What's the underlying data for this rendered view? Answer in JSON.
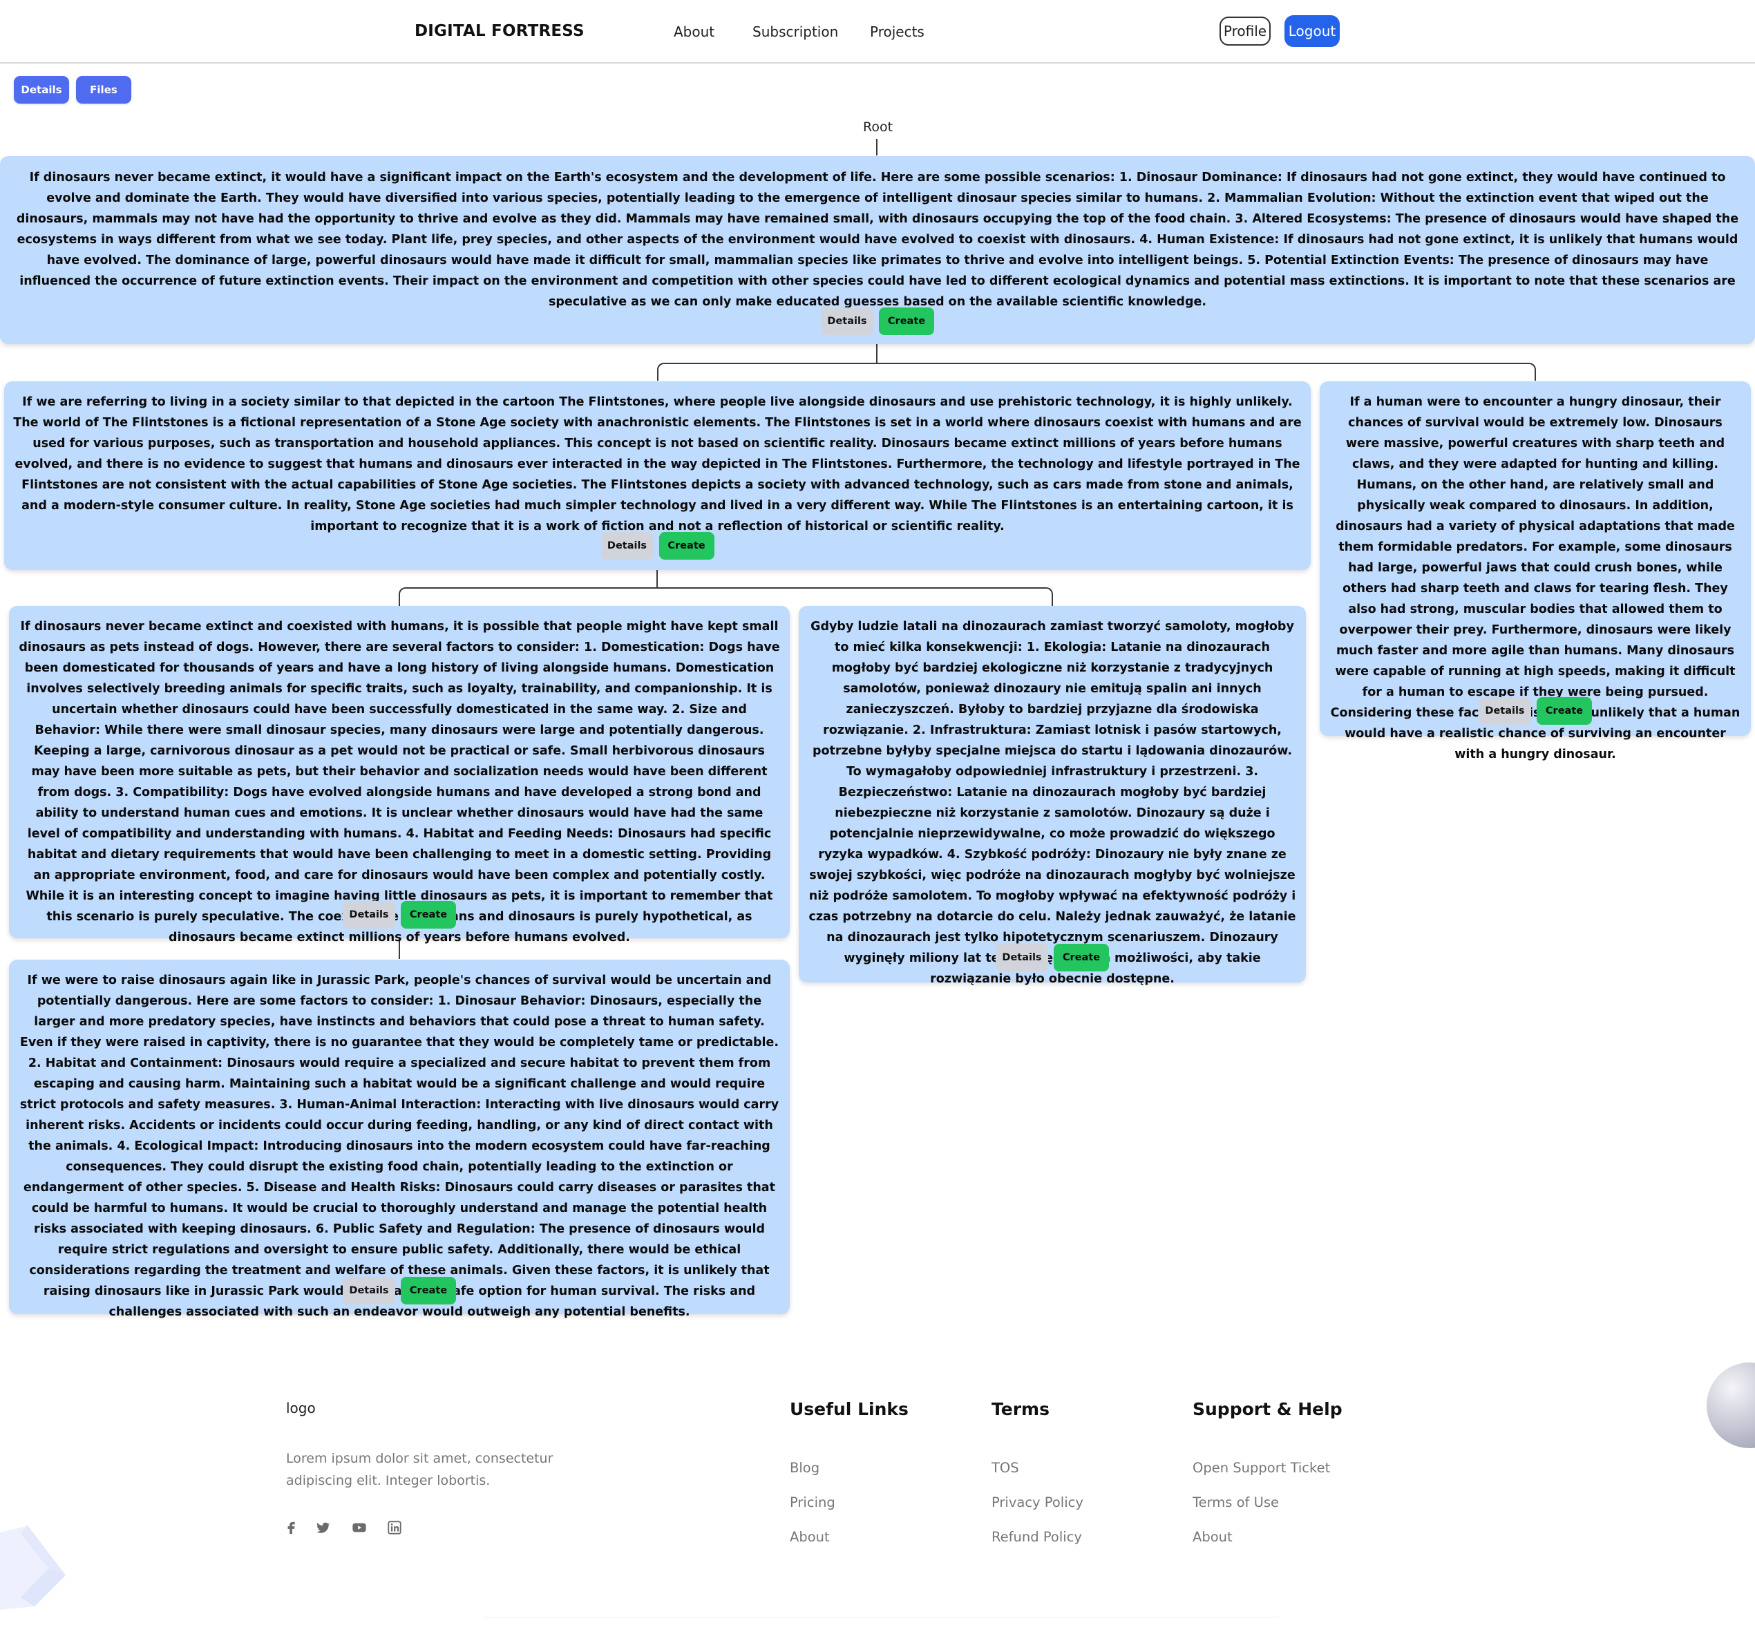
{
  "header": {
    "brand": "DIGITAL FORTRESS",
    "nav": [
      "About",
      "Subscription",
      "Projects"
    ],
    "profile_label": "Profile",
    "logout_label": "Logout"
  },
  "toolbar": {
    "details_label": "Details",
    "files_label": "Files"
  },
  "tree": {
    "root_label": "Root",
    "node_buttons": {
      "details": "Details",
      "create": "Create"
    },
    "nodes": [
      {
        "text": "If dinosaurs never became extinct, it would have a significant impact on the Earth's ecosystem and the development of life. Here are some possible scenarios: 1. Dinosaur Dominance: If dinosaurs had not gone extinct, they would have continued to evolve and dominate the Earth. They would have diversified into various species, potentially leading to the emergence of intelligent dinosaur species similar to humans. 2. Mammalian Evolution: Without the extinction event that wiped out the dinosaurs, mammals may not have had the opportunity to thrive and evolve as they did. Mammals may have remained small, with dinosaurs occupying the top of the food chain. 3. Altered Ecosystems: The presence of dinosaurs would have shaped the ecosystems in ways different from what we see today. Plant life, prey species, and other aspects of the environment would have evolved to coexist with dinosaurs. 4. Human Existence: If dinosaurs had not gone extinct, it is unlikely that humans would have evolved. The dominance of large, powerful dinosaurs would have made it difficult for small, mammalian species like primates to thrive and evolve into intelligent beings. 5. Potential Extinction Events: The presence of dinosaurs may have influenced the occurrence of future extinction events. Their impact on the environment and competition with other species could have led to different ecological dynamics and potential mass extinctions. It is important to note that these scenarios are speculative as we can only make educated guesses based on the available scientific knowledge."
      },
      {
        "text": "If we are referring to living in a society similar to that depicted in the cartoon The Flintstones, where people live alongside dinosaurs and use prehistoric technology, it is highly unlikely. The world of The Flintstones is a fictional representation of a Stone Age society with anachronistic elements. The Flintstones is set in a world where dinosaurs coexist with humans and are used for various purposes, such as transportation and household appliances. This concept is not based on scientific reality. Dinosaurs became extinct millions of years before humans evolved, and there is no evidence to suggest that humans and dinosaurs ever interacted in the way depicted in The Flintstones. Furthermore, the technology and lifestyle portrayed in The Flintstones are not consistent with the actual capabilities of Stone Age societies. The Flintstones depicts a society with advanced technology, such as cars made from stone and animals, and a modern-style consumer culture. In reality, Stone Age societies had much simpler technology and lived in a very different way. While The Flintstones is an entertaining cartoon, it is important to recognize that it is a work of fiction and not a reflection of historical or scientific reality."
      },
      {
        "text": "If a human were to encounter a hungry dinosaur, their chances of survival would be extremely low. Dinosaurs were massive, powerful creatures with sharp teeth and claws, and they were adapted for hunting and killing. Humans, on the other hand, are relatively small and physically weak compared to dinosaurs. In addition, dinosaurs had a variety of physical adaptations that made them formidable predators. For example, some dinosaurs had large, powerful jaws that could crush bones, while others had sharp teeth and claws for tearing flesh. They also had strong, muscular bodies that allowed them to overpower their prey. Furthermore, dinosaurs were likely much faster and more agile than humans. Many dinosaurs were capable of running at high speeds, making it difficult for a human to escape if they were being pursued. Considering these factors, it is highly unlikely that a human would have a realistic chance of surviving an encounter with a hungry dinosaur."
      },
      {
        "text": "If dinosaurs never became extinct and coexisted with humans, it is possible that people might have kept small dinosaurs as pets instead of dogs. However, there are several factors to consider: 1. Domestication: Dogs have been domesticated for thousands of years and have a long history of living alongside humans. Domestication involves selectively breeding animals for specific traits, such as loyalty, trainability, and companionship. It is uncertain whether dinosaurs could have been successfully domesticated in the same way. 2. Size and Behavior: While there were small dinosaur species, many dinosaurs were large and potentially dangerous. Keeping a large, carnivorous dinosaur as a pet would not be practical or safe. Small herbivorous dinosaurs may have been more suitable as pets, but their behavior and socialization needs would have been different from dogs. 3. Compatibility: Dogs have evolved alongside humans and have developed a strong bond and ability to understand human cues and emotions. It is unclear whether dinosaurs would have had the same level of compatibility and understanding with humans. 4. Habitat and Feeding Needs: Dinosaurs had specific habitat and dietary requirements that would have been challenging to meet in a domestic setting. Providing an appropriate environment, food, and care for dinosaurs would have been complex and potentially costly. While it is an interesting concept to imagine having little dinosaurs as pets, it is important to remember that this scenario is purely speculative. The coexistence of humans and dinosaurs is purely hypothetical, as dinosaurs became extinct millions of years before humans evolved."
      },
      {
        "text": "Gdyby ludzie latali na dinozaurach zamiast tworzyć samoloty, mogłoby to mieć kilka konsekwencji: 1. Ekologia: Latanie na dinozaurach mogłoby być bardziej ekologiczne niż korzystanie z tradycyjnych samolotów, ponieważ dinozaury nie emitują spalin ani innych zanieczyszczeń. Byłoby to bardziej przyjazne dla środowiska rozwiązanie. 2. Infrastruktura: Zamiast lotnisk i pasów startowych, potrzebne byłyby specjalne miejsca do startu i lądowania dinozaurów. To wymagałoby odpowiedniej infrastruktury i przestrzeni. 3. Bezpieczeństwo: Latanie na dinozaurach mogłoby być bardziej niebezpieczne niż korzystanie z samolotów. Dinozaury są duże i potencjalnie nieprzewidywalne, co może prowadzić do większego ryzyka wypadków. 4. Szybkość podróży: Dinozaury nie były znane ze swojej szybkości, więc podróże na dinozaurach mogłyby być wolniejsze niż podróże samolotem. To mogłoby wpływać na efektywność podróży i czas potrzebny na dotarcie do celu. Należy jednak zauważyć, że latanie na dinozaurach jest tylko hipotetycznym scenariuszem. Dinozaury wyginęły miliony lat temu, więc nie ma możliwości, aby takie rozwiązanie było obecnie dostępne."
      },
      {
        "text": "If we were to raise dinosaurs again like in Jurassic Park, people's chances of survival would be uncertain and potentially dangerous. Here are some factors to consider: 1. Dinosaur Behavior: Dinosaurs, especially the larger and more predatory species, have instincts and behaviors that could pose a threat to human safety. Even if they were raised in captivity, there is no guarantee that they would be completely tame or predictable. 2. Habitat and Containment: Dinosaurs would require a specialized and secure habitat to prevent them from escaping and causing harm. Maintaining such a habitat would be a significant challenge and would require strict protocols and safety measures. 3. Human-Animal Interaction: Interacting with live dinosaurs would carry inherent risks. Accidents or incidents could occur during feeding, handling, or any kind of direct contact with the animals. 4. Ecological Impact: Introducing dinosaurs into the modern ecosystem could have far-reaching consequences. They could disrupt the existing food chain, potentially leading to the extinction or endangerment of other species. 5. Disease and Health Risks: Dinosaurs could carry diseases or parasites that could be harmful to humans. It would be crucial to thoroughly understand and manage the potential health risks associated with keeping dinosaurs. 6. Public Safety and Regulation: The presence of dinosaurs would require strict regulations and oversight to ensure public safety. Additionally, there would be ethical considerations regarding the treatment and welfare of these animals. Given these factors, it is unlikely that raising dinosaurs like in Jurassic Park would be a viable or safe option for human survival. The risks and challenges associated with such an endeavor would outweigh any potential benefits."
      }
    ]
  },
  "footer": {
    "logo": "logo",
    "description": "Lorem ipsum dolor sit amet, consectetur adipiscing elit. Integer lobortis.",
    "social_icons": [
      "facebook-icon",
      "twitter-icon",
      "youtube-icon",
      "linkedin-icon"
    ],
    "columns": [
      {
        "title": "Useful Links",
        "links": [
          "Blog",
          "Pricing",
          "About"
        ]
      },
      {
        "title": "Terms",
        "links": [
          "TOS",
          "Privacy Policy",
          "Refund Policy"
        ]
      },
      {
        "title": "Support & Help",
        "links": [
          "Open Support Ticket",
          "Terms of Use",
          "About"
        ]
      }
    ]
  },
  "colors": {
    "primary": "#2563eb",
    "tab_button": "#4f6cf1",
    "node_background": "#bfdbfe",
    "create_button": "#22c55e",
    "details_button": "#d1d5db"
  }
}
